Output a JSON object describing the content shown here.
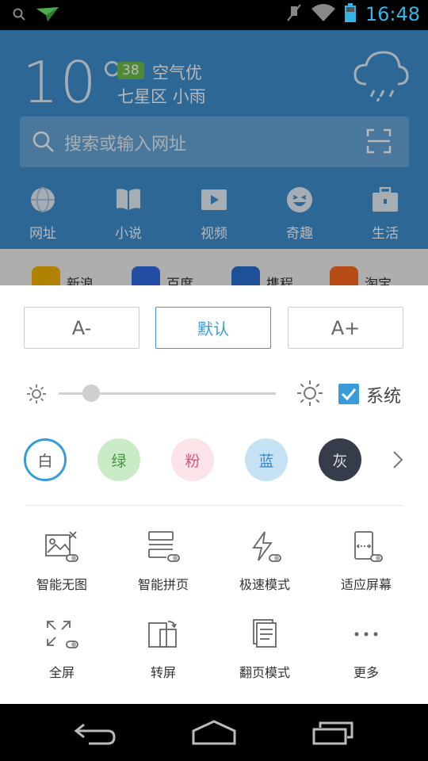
{
  "status_bar": {
    "time": "16:48",
    "icons": [
      "search-icon",
      "airplane-notification-icon",
      "mute-icon",
      "wifi-icon",
      "battery-icon"
    ],
    "accent_color": "#33b5e5"
  },
  "weather": {
    "temperature": "10°",
    "aqi_value": "38",
    "aqi_label": "空气优",
    "location": "七星区  小雨",
    "icon": "rain-cloud-icon"
  },
  "search": {
    "placeholder": "搜索或输入网址",
    "scan_icon": "scan-icon"
  },
  "nav": {
    "items": [
      {
        "label": "网址",
        "icon": "globe-icon"
      },
      {
        "label": "小说",
        "icon": "book-icon"
      },
      {
        "label": "视频",
        "icon": "video-icon"
      },
      {
        "label": "奇趣",
        "icon": "laugh-face-icon"
      },
      {
        "label": "生活",
        "icon": "briefcase-icon"
      }
    ]
  },
  "sites": {
    "items": [
      {
        "name": "新浪",
        "color": "#f5b400"
      },
      {
        "name": "百度",
        "color": "#2f6de1"
      },
      {
        "name": "携程",
        "color": "#2a6fd1"
      },
      {
        "name": "淘宝",
        "color": "#ff6a1f"
      }
    ]
  },
  "panel": {
    "font_size": {
      "decrease_label": "A-",
      "default_label": "默认",
      "increase_label": "A+",
      "selected": "默认"
    },
    "brightness": {
      "level_percent": 15,
      "system_label": "系统",
      "system_checked": true
    },
    "themes": [
      {
        "label": "白",
        "bg": "#ffffff",
        "fg": "#555555",
        "selected": true
      },
      {
        "label": "绿",
        "bg": "#c9ecc6",
        "fg": "#3f9a3c",
        "selected": false
      },
      {
        "label": "粉",
        "bg": "#fbe3e8",
        "fg": "#d25a7a",
        "selected": false
      },
      {
        "label": "蓝",
        "bg": "#c6e3f5",
        "fg": "#3a86c2",
        "selected": false
      },
      {
        "label": "灰",
        "bg": "#373c4a",
        "fg": "#dddddd",
        "selected": false
      }
    ],
    "tools_row1": [
      {
        "label": "智能无图",
        "icon": "no-image-icon"
      },
      {
        "label": "智能拼页",
        "icon": "page-merge-icon"
      },
      {
        "label": "极速模式",
        "icon": "lightning-icon"
      },
      {
        "label": "适应屏幕",
        "icon": "fit-screen-icon"
      }
    ],
    "tools_row2": [
      {
        "label": "全屏",
        "icon": "fullscreen-icon"
      },
      {
        "label": "转屏",
        "icon": "rotate-screen-icon"
      },
      {
        "label": "翻页模式",
        "icon": "page-turn-icon"
      },
      {
        "label": "更多",
        "icon": "more-icon"
      }
    ],
    "accent_color": "#3a9bd9"
  },
  "navbar": {
    "buttons": [
      "back-icon",
      "home-icon",
      "recents-icon"
    ]
  }
}
